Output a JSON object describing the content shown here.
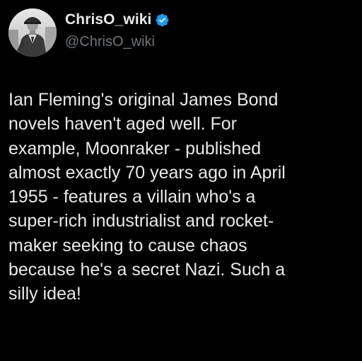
{
  "author": {
    "display_name": "ChrisO_wiki",
    "handle": "@ChrisO_wiki",
    "verified": true,
    "verified_badge_color": "#1d9bf0",
    "avatar_icon": "vintage-photo-man-in-uniform"
  },
  "tweet": {
    "text": "Ian Fleming's original James Bond\nnovels haven't aged well. For\nexample, Moonraker - published\nalmost exactly 70 years ago in April\n1955 - features a villain who's a\nsuper-rich industrialist and rocket-\nmaker seeking to cause chaos\nbecause he's a secret Nazi. Such a\nsilly idea!"
  },
  "colors": {
    "background": "#000000",
    "primary_text": "#e7e9ea",
    "secondary_text": "#71767b"
  }
}
